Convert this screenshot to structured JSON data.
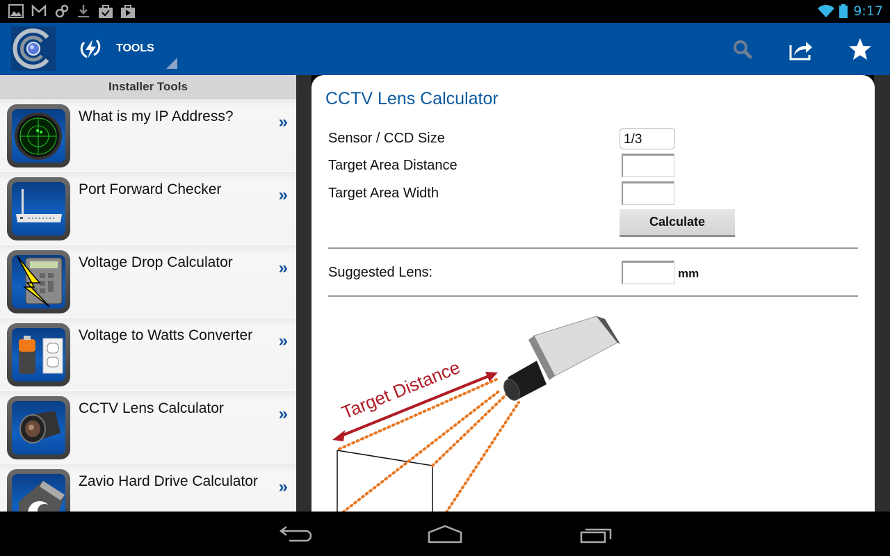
{
  "status_bar": {
    "time": "9:17",
    "notification_icons": [
      "gallery-icon",
      "gmail-icon",
      "sync-icon",
      "download-icon",
      "play-store-updated-icon",
      "play-store-icon"
    ],
    "system_icons": [
      "wifi-icon",
      "battery-icon"
    ]
  },
  "action_bar": {
    "tools_label": "TOOLS",
    "actions": [
      "search-icon",
      "share-icon",
      "star-icon"
    ]
  },
  "sidebar": {
    "header": "Installer Tools",
    "items": [
      {
        "label": "What is my IP Address?",
        "icon": "radar-icon"
      },
      {
        "label": "Port Forward Checker",
        "icon": "router-icon"
      },
      {
        "label": "Voltage Drop Calculator",
        "icon": "calculator-bolt-icon"
      },
      {
        "label": "Voltage to Watts Converter",
        "icon": "battery-outlet-icon"
      },
      {
        "label": "CCTV Lens Calculator",
        "icon": "camera-lens-icon"
      },
      {
        "label": "Zavio Hard Drive Calculator",
        "icon": "zavio-logo-icon"
      }
    ],
    "arrow_glyph": "»"
  },
  "panel": {
    "title": "CCTV Lens Calculator",
    "sensor_label": "Sensor / CCD Size",
    "sensor_value": "1/3",
    "distance_label": "Target Area Distance",
    "distance_value": "",
    "width_label": "Target Area Width",
    "width_value": "",
    "calculate_label": "Calculate",
    "suggested_label": "Suggested Lens:",
    "suggested_value": "",
    "unit_label": "mm",
    "diagram_label": "Target Distance"
  },
  "colors": {
    "action_bar": "#0050a0",
    "title_blue": "#0d5aa0",
    "arrow_red": "#b01c24",
    "dotted_orange": "#e87722"
  }
}
